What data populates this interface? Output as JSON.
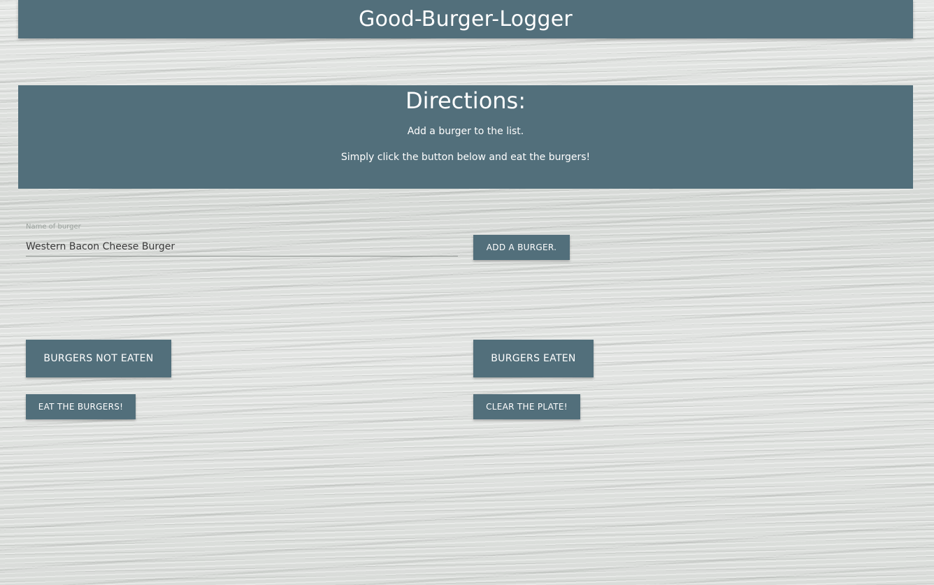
{
  "header": {
    "title": "Good-Burger-Logger"
  },
  "directions": {
    "title": "Directions:",
    "line1": "Add a burger to the list.",
    "line2": "Simply click the button below and eat the burgers!"
  },
  "form": {
    "label": "Name of burger",
    "value": "Western Bacon Cheese Burger",
    "add_button": "ADD A BURGER."
  },
  "lists": {
    "not_eaten_button": "BURGERS NOT EATEN",
    "eaten_button": "BURGERS EATEN",
    "eat_button": "EAT THE BURGERS!",
    "clear_button": "CLEAR THE PLATE!"
  },
  "colors": {
    "primary": "#526f7b",
    "text_light": "#ffffff",
    "background": "#dcdfdc"
  }
}
